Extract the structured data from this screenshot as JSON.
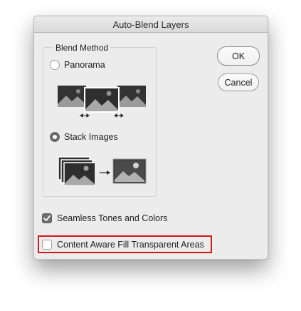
{
  "dialog": {
    "title": "Auto-Blend Layers"
  },
  "blend_method": {
    "label": "Blend Method",
    "options": [
      {
        "label": "Panorama",
        "selected": false,
        "illustration": "panorama-overlap-icon"
      },
      {
        "label": "Stack Images",
        "selected": true,
        "illustration": "stack-images-icon"
      }
    ]
  },
  "buttons": {
    "ok": "OK",
    "cancel": "Cancel"
  },
  "options": {
    "seamless": {
      "label": "Seamless Tones and Colors",
      "checked": true
    },
    "content_aware": {
      "label": "Content Aware Fill Transparent Areas",
      "checked": false
    }
  },
  "colors": {
    "highlight": "#d01818",
    "dialog_bg": "#ececec"
  }
}
